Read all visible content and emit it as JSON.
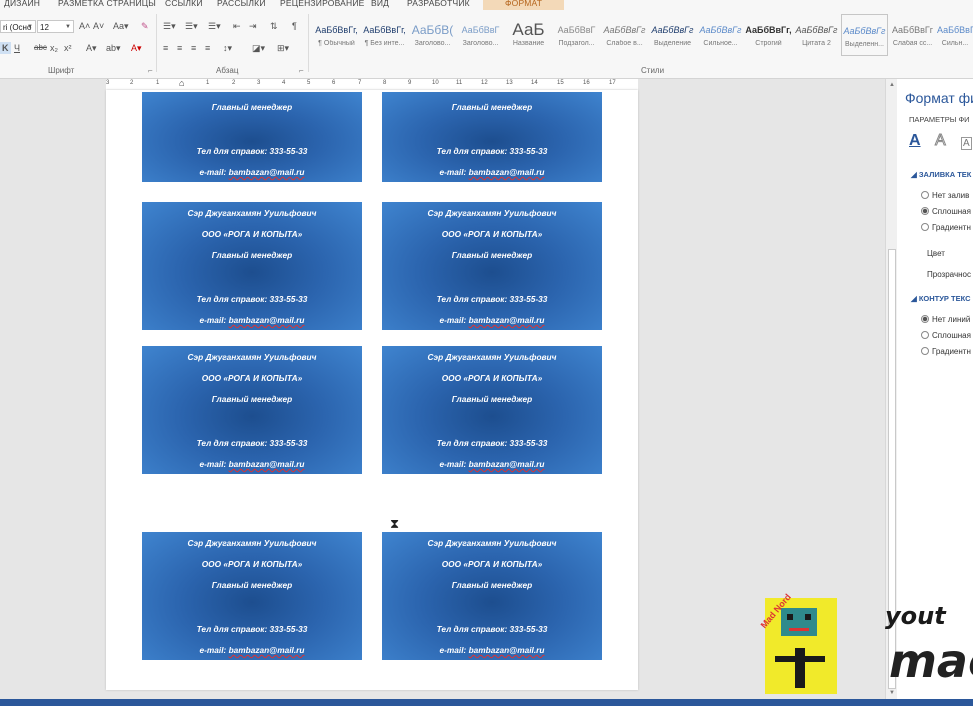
{
  "ribbon": {
    "tabs": [
      "ДИЗАЙН",
      "РАЗМЕТКА СТРАНИЦЫ",
      "ССЫЛКИ",
      "РАССЫЛКИ",
      "РЕЦЕНЗИРОВАНИЕ",
      "ВИД",
      "РАЗРАБОТЧИК",
      "ФОРМАТ"
    ],
    "font_name": "ri (Осно",
    "font_size": "12",
    "group_font": "Шрифт",
    "group_paragraph": "Абзац",
    "group_styles": "Стили",
    "styles": [
      {
        "sample": "АаБбВвГг,",
        "name": "¶ Обычный"
      },
      {
        "sample": "АаБбВвГг,",
        "name": "¶ Без инте..."
      },
      {
        "sample": "АаБбВ(",
        "name": "Заголово..."
      },
      {
        "sample": "АаБбВвГ",
        "name": "Заголово..."
      },
      {
        "sample": "АаБ",
        "name": "Название"
      },
      {
        "sample": "АаБбВвГ",
        "name": "Подзагол..."
      },
      {
        "sample": "АаБбВвГг",
        "name": "Слабое в..."
      },
      {
        "sample": "АаБбВвГг",
        "name": "Выделение"
      },
      {
        "sample": "АаБбВвГг",
        "name": "Сильное..."
      },
      {
        "sample": "АаБбВвГг,",
        "name": "Строгий"
      },
      {
        "sample": "АаБбВвГг",
        "name": "Цитата 2"
      },
      {
        "sample": "АаБбВвГг",
        "name": "Выделенн..."
      },
      {
        "sample": "АаБбВвГг",
        "name": "Слабая сс..."
      },
      {
        "sample": "АаБбВвГг",
        "name": "Сильн..."
      }
    ]
  },
  "ruler": [
    "3",
    "2",
    "1",
    "1",
    "2",
    "3",
    "4",
    "5",
    "6",
    "7",
    "8",
    "9",
    "10",
    "11",
    "12",
    "13",
    "14",
    "15",
    "16",
    "17"
  ],
  "card": {
    "name": "Сэр Джуганхамян Ууильфович",
    "company": "ООО «РОГА И КОПЫТА»",
    "position": "Главный менеджер",
    "phone": "Тел для справок: 333-55-33",
    "email_prefix": "e-mail: ",
    "email": "bambazan@mail.ru"
  },
  "pane": {
    "title": "Формат фи",
    "subtitle": "ПАРАМЕТРЫ ФИ",
    "fill_section": "ЗАЛИВКА ТЕК",
    "fill_options": [
      "Нет залив",
      "Сплошная",
      "Градиентн"
    ],
    "color_label": "Цвет",
    "transparency_label": "Прозрачнос",
    "outline_section": "КОНТУР ТЕКС",
    "outline_options": [
      "Нет линий",
      "Сплошная",
      "Градиентн"
    ]
  },
  "watermark": {
    "line1": "yout",
    "line2": "mac",
    "mascot_text": "Mad Nord"
  },
  "colors": {
    "card_dark": "#1d4e8f",
    "card_light": "#3f84cf",
    "accent": "#2b579a"
  }
}
